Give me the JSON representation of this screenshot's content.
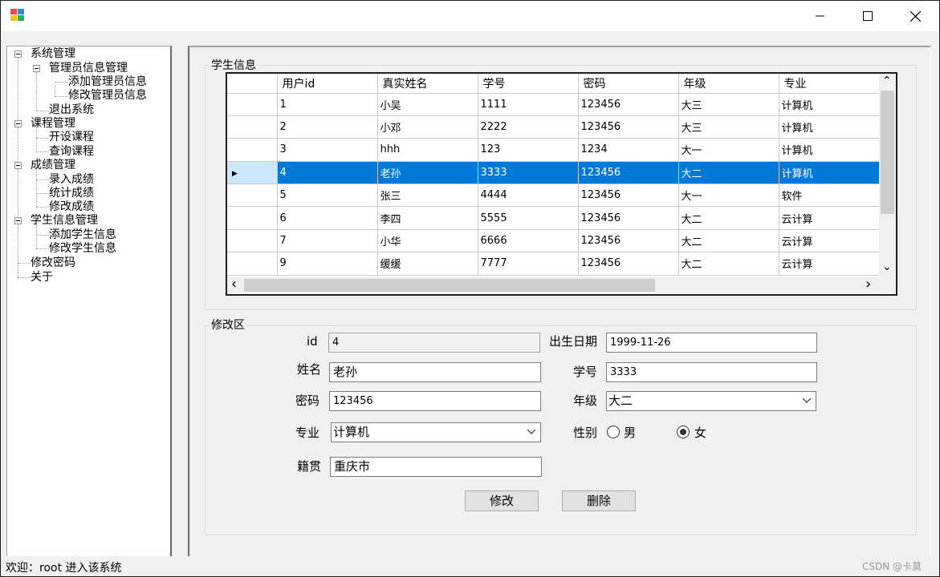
{
  "window": {
    "title": "",
    "min_glyph": "─",
    "max_glyph": "☐",
    "close_glyph": "✕",
    "icon_colors": [
      "#e74c3c",
      "#2e86de",
      "#f1c40f",
      "#27ae60"
    ]
  },
  "tree": {
    "nodes": [
      {
        "label": "系统管理",
        "level": 0,
        "expanded": true
      },
      {
        "label": "管理员信息管理",
        "level": 1,
        "expanded": true
      },
      {
        "label": "添加管理员信息",
        "level": 2
      },
      {
        "label": "修改管理员信息",
        "level": 2
      },
      {
        "label": "退出系统",
        "level": 1
      },
      {
        "label": "课程管理",
        "level": 0,
        "expanded": true
      },
      {
        "label": "开设课程",
        "level": 1
      },
      {
        "label": "查询课程",
        "level": 1
      },
      {
        "label": "成绩管理",
        "level": 0,
        "expanded": true
      },
      {
        "label": "录入成绩",
        "level": 1
      },
      {
        "label": "统计成绩",
        "level": 1
      },
      {
        "label": "修改成绩",
        "level": 1
      },
      {
        "label": "学生信息管理",
        "level": 0,
        "expanded": true
      },
      {
        "label": "添加学生信息",
        "level": 1
      },
      {
        "label": "修改学生信息",
        "level": 1
      },
      {
        "label": "修改密码",
        "level": 0
      },
      {
        "label": "关于",
        "level": 0
      }
    ]
  },
  "student_group": {
    "title": "学生信息",
    "columns": [
      "用户id",
      "真实姓名",
      "学号",
      "密码",
      "年级",
      "专业"
    ],
    "rows": [
      [
        "1",
        "小吴",
        "1111",
        "123456",
        "大三",
        "计算机"
      ],
      [
        "2",
        "小邓",
        "2222",
        "123456",
        "大三",
        "计算机"
      ],
      [
        "3",
        "hhh",
        "123",
        "1234",
        "大一",
        "计算机"
      ],
      [
        "4",
        "老孙",
        "3333",
        "123456",
        "大二",
        "计算机"
      ],
      [
        "5",
        "张三",
        "4444",
        "123456",
        "大一",
        "软件"
      ],
      [
        "6",
        "李四",
        "5555",
        "123456",
        "大二",
        "云计算"
      ],
      [
        "7",
        "小华",
        "6666",
        "123456",
        "大二",
        "云计算"
      ],
      [
        "9",
        "缓缓",
        "7777",
        "123456",
        "大二",
        "云计算"
      ]
    ],
    "selected_row": 3,
    "row_indicator": "▶",
    "scroll_up": "⌃",
    "scroll_down": "⌄",
    "scroll_left": "‹",
    "scroll_right": "›"
  },
  "edit_group": {
    "title": "修改区",
    "id_label": "id",
    "id_value": "4",
    "birth_label": "出生日期",
    "birth_value": "1999-11-26",
    "name_label": "姓名",
    "name_value": "老孙",
    "stuno_label": "学号",
    "stuno_value": "3333",
    "pwd_label": "密码",
    "pwd_value": "123456",
    "grade_label": "年级",
    "grade_value": "大二",
    "major_label": "专业",
    "major_value": "计算机",
    "gender_label": "性别",
    "gender_male": "男",
    "gender_female": "女",
    "gender_selected": "女",
    "hometown_label": "籍贯",
    "hometown_value": "重庆市",
    "modify_button": "修改",
    "delete_button": "删除"
  },
  "status": {
    "text": "欢迎：root 进入该系统",
    "watermark": "CSDN @卡莫"
  }
}
